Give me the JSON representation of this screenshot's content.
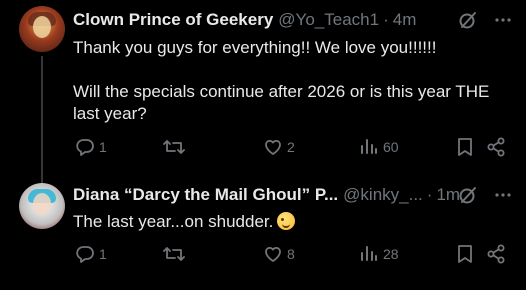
{
  "tweets": [
    {
      "author_name": "Clown Prince of Geekery",
      "handle": "@Yo_Teach1",
      "separator": "·",
      "time": "4m",
      "paragraphs": [
        "Thank you guys for everything!! We love you!!!!!!",
        "Will the specials continue after 2026 or is this year THE last year?"
      ],
      "stats": {
        "replies": "1",
        "retweets": "",
        "likes": "2",
        "views": "60"
      }
    },
    {
      "author_name": "Diana “Darcy the Mail Ghoul” P...",
      "handle": "@kinky_...",
      "separator": "·",
      "time": "1m",
      "paragraphs": [
        "The last year...on shudder."
      ],
      "emoji": "winking-face",
      "stats": {
        "replies": "1",
        "retweets": "",
        "likes": "8",
        "views": "28"
      }
    }
  ],
  "icons": {
    "grok": "grok-icon",
    "more": "more-icon",
    "reply": "reply-icon",
    "retweet": "retweet-icon",
    "like": "heart-icon",
    "views": "views-icon",
    "bookmark": "bookmark-icon",
    "share": "share-icon"
  },
  "colors": {
    "background": "#000000",
    "text": "#e7e9ea",
    "muted": "#71767b",
    "thread_line": "#333639"
  }
}
